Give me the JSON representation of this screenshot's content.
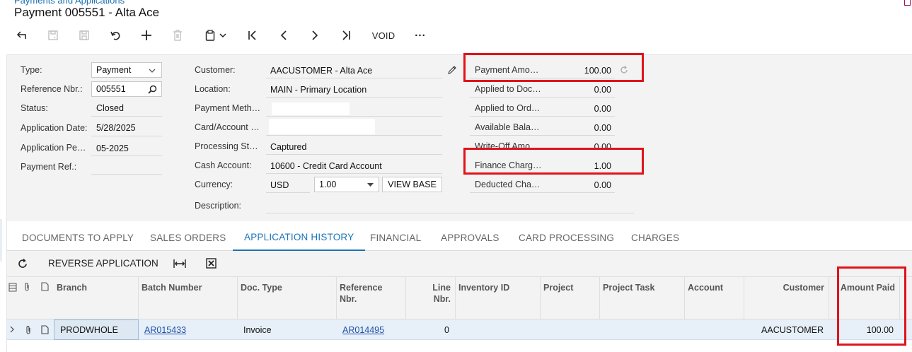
{
  "header": {
    "breadcrumb": "Payments and Applications",
    "title": "Payment 005551 - Alta Ace"
  },
  "toolbar": {
    "void_label": "VOID",
    "more_label": "···"
  },
  "form": {
    "type_label": "Type:",
    "type_value": "Payment",
    "ref_label": "Reference Nbr.:",
    "ref_value": "005551",
    "status_label": "Status:",
    "status_value": "Closed",
    "app_date_label": "Application Date:",
    "app_date_value": "5/28/2025",
    "app_period_label": "Application Pe…",
    "app_period_value": "05-2025",
    "payment_ref_label": "Payment Ref.:",
    "customer_label": "Customer:",
    "customer_value": "AACUSTOMER - Alta Ace",
    "location_label": "Location:",
    "location_value": "MAIN - Primary Location",
    "payment_method_label": "Payment Meth…",
    "card_account_label": "Card/Account …",
    "processing_status_label": "Processing St…",
    "processing_status_value": "Captured",
    "cash_account_label": "Cash Account:",
    "cash_account_value": "10600 - Credit Card Account",
    "currency_label": "Currency:",
    "currency_value": "USD",
    "currency_rate": "1.00",
    "view_base_label": "VIEW BASE",
    "description_label": "Description:",
    "payment_amount_label": "Payment Amo…",
    "payment_amount_value": "100.00",
    "applied_docs_label": "Applied to Doc…",
    "applied_docs_value": "0.00",
    "applied_orders_label": "Applied to Ord…",
    "applied_orders_value": "0.00",
    "available_balance_label": "Available Bala…",
    "available_balance_value": "0.00",
    "writeoff_label": "Write-Off Amo…",
    "writeoff_value": "0.00",
    "finance_charge_label": "Finance Charg…",
    "finance_charge_value": "1.00",
    "deducted_label": "Deducted Cha…",
    "deducted_value": "0.00"
  },
  "tabs": [
    {
      "label": "DOCUMENTS TO APPLY",
      "active": false
    },
    {
      "label": "SALES ORDERS",
      "active": false
    },
    {
      "label": "APPLICATION HISTORY",
      "active": true
    },
    {
      "label": "FINANCIAL",
      "active": false
    },
    {
      "label": "APPROVALS",
      "active": false
    },
    {
      "label": "CARD PROCESSING",
      "active": false
    },
    {
      "label": "CHARGES",
      "active": false
    }
  ],
  "grid_toolbar": {
    "reverse_label": "REVERSE APPLICATION"
  },
  "grid": {
    "columns": [
      "Branch",
      "Batch Number",
      "Doc. Type",
      "Reference Nbr.",
      "Line Nbr.",
      "Inventory ID",
      "Project",
      "Project Task",
      "Account",
      "Customer",
      "Amount Paid"
    ],
    "rows": [
      {
        "branch": "PRODWHOLE",
        "batch_number": "AR015433",
        "doc_type": "Invoice",
        "reference_nbr": "AR014495",
        "line_nbr": "0",
        "inventory_id": "",
        "project": "",
        "project_task": "",
        "account": "",
        "customer": "AACUSTOMER",
        "amount_paid": "100.00"
      }
    ]
  },
  "colors": {
    "accent": "#1a74b8",
    "highlight": "#e0131b",
    "link": "#1f4fa8",
    "row_selected": "#e7f0f8"
  }
}
